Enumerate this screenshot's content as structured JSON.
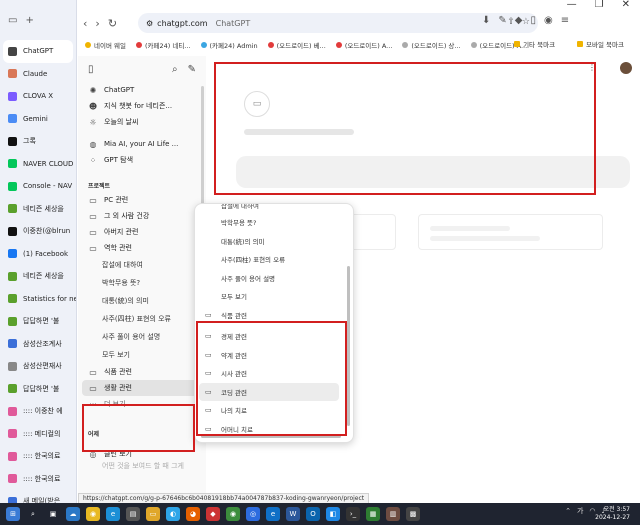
{
  "tabs": [
    {
      "label": "ChatGPT",
      "color": "#444444",
      "active": true
    },
    {
      "label": "Claude",
      "color": "#d97757"
    },
    {
      "label": "CLOVA X",
      "color": "#7b5cff"
    },
    {
      "label": "Gemini",
      "color": "#4b8cf5"
    },
    {
      "label": "그록",
      "color": "#111111"
    },
    {
      "label": "NAVER CLOUD",
      "color": "#03c75a"
    },
    {
      "label": "Console - NAV",
      "color": "#03c75a"
    },
    {
      "label": "네티즌 세상을",
      "color": "#5aa02c"
    },
    {
      "label": "이중찬(@blrun",
      "color": "#111111"
    },
    {
      "label": "(1) Facebook",
      "color": "#1877f2"
    },
    {
      "label": "네티즌 세상을",
      "color": "#5aa02c"
    },
    {
      "label": "Statistics for ne",
      "color": "#5aa02c"
    },
    {
      "label": "답답하면 '불",
      "color": "#5aa02c"
    },
    {
      "label": "삼성산조계사",
      "color": "#3b6fd8"
    },
    {
      "label": "삼성산편재사",
      "color": "#888888"
    },
    {
      "label": "답답하면 '불",
      "color": "#5aa02c"
    },
    {
      "label": ":::: 이중찬 에",
      "color": "#e05a9a"
    },
    {
      "label": ":::: 메디컬의",
      "color": "#e05a9a"
    },
    {
      "label": ":::: 한국의료",
      "color": "#e05a9a"
    },
    {
      "label": ":::: 한국의료",
      "color": "#e05a9a"
    },
    {
      "label": "새 메일(받은",
      "color": "#3b6fd8"
    }
  ],
  "omnibox": {
    "host": "chatgpt.com",
    "title": "ChatGPT"
  },
  "bookmarks": [
    {
      "label": "네이버 웨일",
      "color": "#f0b400"
    },
    {
      "label": "(카페24) 네티...",
      "color": "#e23b3b"
    },
    {
      "label": "(카페24) Admin",
      "color": "#3ba6e2"
    },
    {
      "label": "(오드로이드) 베...",
      "color": "#e23b3b"
    },
    {
      "label": "(오드로이드) A...",
      "color": "#e23b3b"
    },
    {
      "label": "(오드로이드) 상...",
      "color": "#aaaaaa"
    },
    {
      "label": "(오드로이드) A...",
      "color": "#aaaaaa"
    }
  ],
  "bookmarks_right": [
    "기타 북마크",
    "모바일 북마크"
  ],
  "sidebar": {
    "top": [
      {
        "label": "ChatGPT",
        "icon": "openai-icon"
      },
      {
        "label": "지식 챗봇 for 네티즌...",
        "icon": "bot-avatar-icon"
      },
      {
        "label": "오늘의 날씨",
        "icon": "weather-icon"
      }
    ],
    "gpts": [
      {
        "label": "Mia AI, your AI Life ...",
        "icon": "mia-icon"
      },
      {
        "label": "GPT 탐색",
        "icon": "grid-icon"
      }
    ],
    "projects_heading": "프로젝트",
    "projects": [
      {
        "label": "PC 관련"
      },
      {
        "label": "그 외 사람 건강"
      },
      {
        "label": "아버지 관련"
      },
      {
        "label": "역학 관련"
      }
    ],
    "subitems": [
      "잡설에 대하여",
      "박학무용 뜻?",
      "대통(統)의 의미",
      "사주(四柱) 표현의 오류",
      "사주 풀이 용어 설명",
      "모두 보기"
    ],
    "projects2": [
      {
        "label": "식품 관련"
      },
      {
        "label": "생활 관련",
        "highlight": true
      }
    ],
    "more": "더 보기",
    "yesterday_heading": "어제",
    "recent": [
      {
        "label": "클린 보기"
      }
    ],
    "recent_partial": "어떤 것을 보여드 할 때 그게"
  },
  "popup": {
    "partial_top": "잡설에 대하여",
    "subitems": [
      "박학무용 뜻?",
      "대통(統)의 의미",
      "사주(四柱) 표현의 오류",
      "사주 풀이 용어 설명",
      "모두 보기"
    ],
    "folder_first": "식품 관련",
    "folders": [
      {
        "label": "경제 관련"
      },
      {
        "label": "약계 관련"
      },
      {
        "label": "시사 관련"
      },
      {
        "label": "코딩 관련",
        "highlight": true
      },
      {
        "label": "나의 치료"
      },
      {
        "label": "어머니 치료"
      }
    ]
  },
  "status_url": "https://chatgpt.com/g/g-p-67646bc6b04081918bb74a004787b837-koding-gwanryeon/project",
  "clock": {
    "time": "오전 3:57",
    "date": "2024-12-27"
  }
}
